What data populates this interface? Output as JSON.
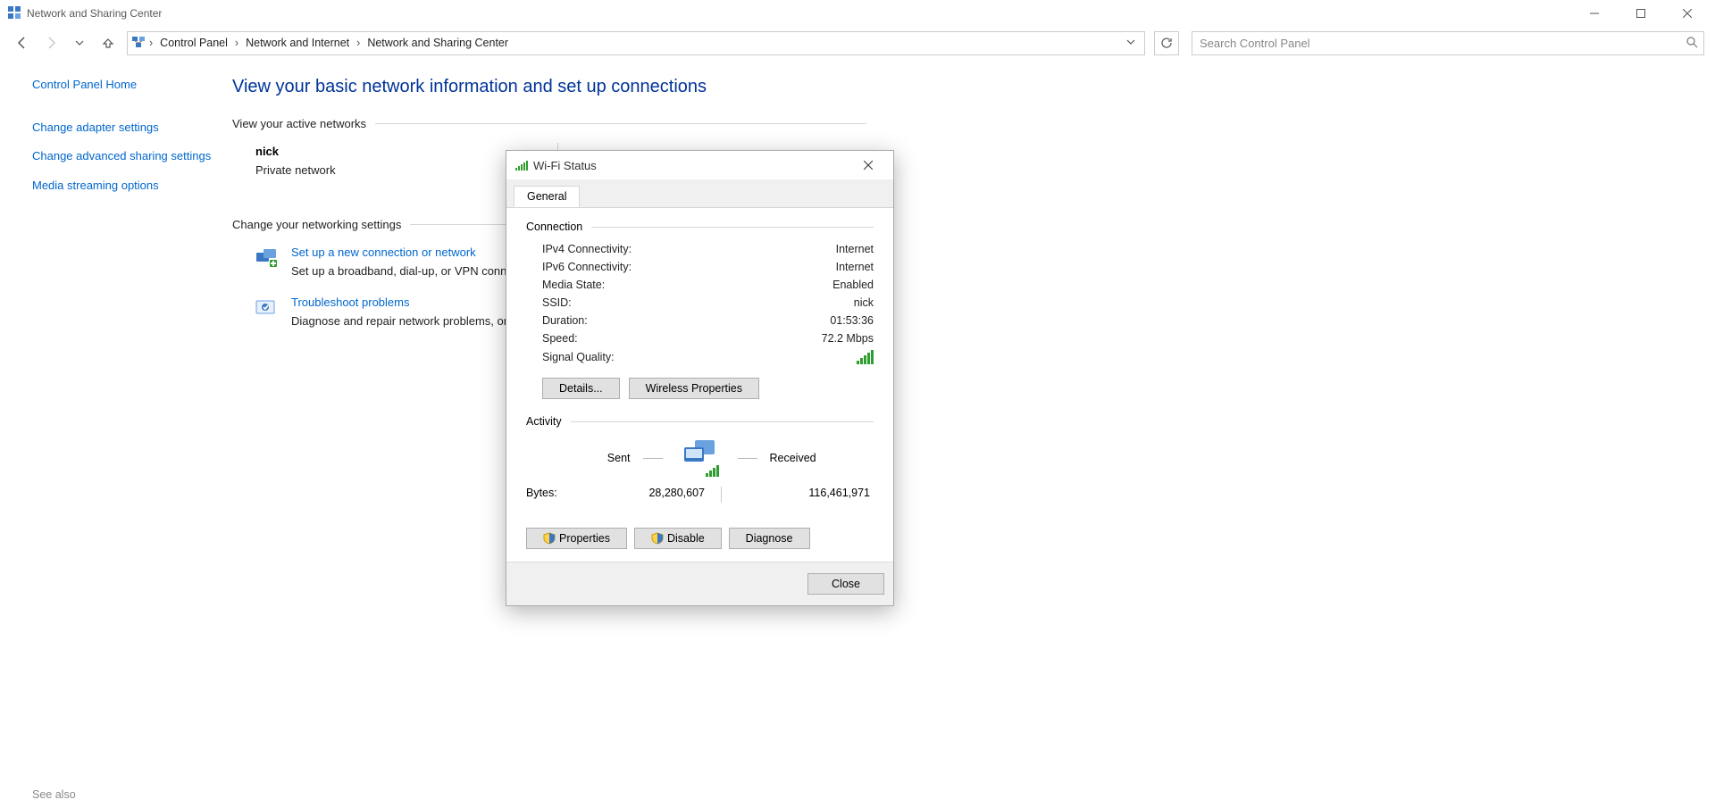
{
  "window": {
    "title": "Network and Sharing Center"
  },
  "breadcrumbs": {
    "items": [
      "Control Panel",
      "Network and Internet",
      "Network and Sharing Center"
    ]
  },
  "search": {
    "placeholder": "Search Control Panel"
  },
  "sidebar": {
    "home": "Control Panel Home",
    "links": [
      "Change adapter settings",
      "Change advanced sharing settings",
      "Media streaming options"
    ]
  },
  "page": {
    "title": "View your basic network information and set up connections",
    "active_networks_label": "View your active networks",
    "network": {
      "name": "nick",
      "type": "Private network"
    },
    "change_settings_label": "Change your networking settings",
    "settings": [
      {
        "title": "Set up a new connection or network",
        "desc": "Set up a broadband, dial-up, or VPN connection; or set up a router or access point."
      },
      {
        "title": "Troubleshoot problems",
        "desc": "Diagnose and repair network problems, or get troubleshooting information."
      }
    ],
    "see_also": "See also"
  },
  "dialog": {
    "title": "Wi-Fi Status",
    "tab": "General",
    "group_connection": "Connection",
    "conn": {
      "ipv4_label": "IPv4 Connectivity:",
      "ipv4_value": "Internet",
      "ipv6_label": "IPv6 Connectivity:",
      "ipv6_value": "Internet",
      "media_label": "Media State:",
      "media_value": "Enabled",
      "ssid_label": "SSID:",
      "ssid_value": "nick",
      "duration_label": "Duration:",
      "duration_value": "01:53:36",
      "speed_label": "Speed:",
      "speed_value": "72.2 Mbps",
      "signal_label": "Signal Quality:"
    },
    "buttons": {
      "details": "Details...",
      "wireless": "Wireless Properties"
    },
    "group_activity": "Activity",
    "activity": {
      "sent_label": "Sent",
      "received_label": "Received",
      "bytes_label": "Bytes:",
      "sent_bytes": "28,280,607",
      "received_bytes": "116,461,971"
    },
    "admin_buttons": {
      "properties": "Properties",
      "disable": "Disable",
      "diagnose": "Diagnose"
    },
    "close": "Close"
  }
}
